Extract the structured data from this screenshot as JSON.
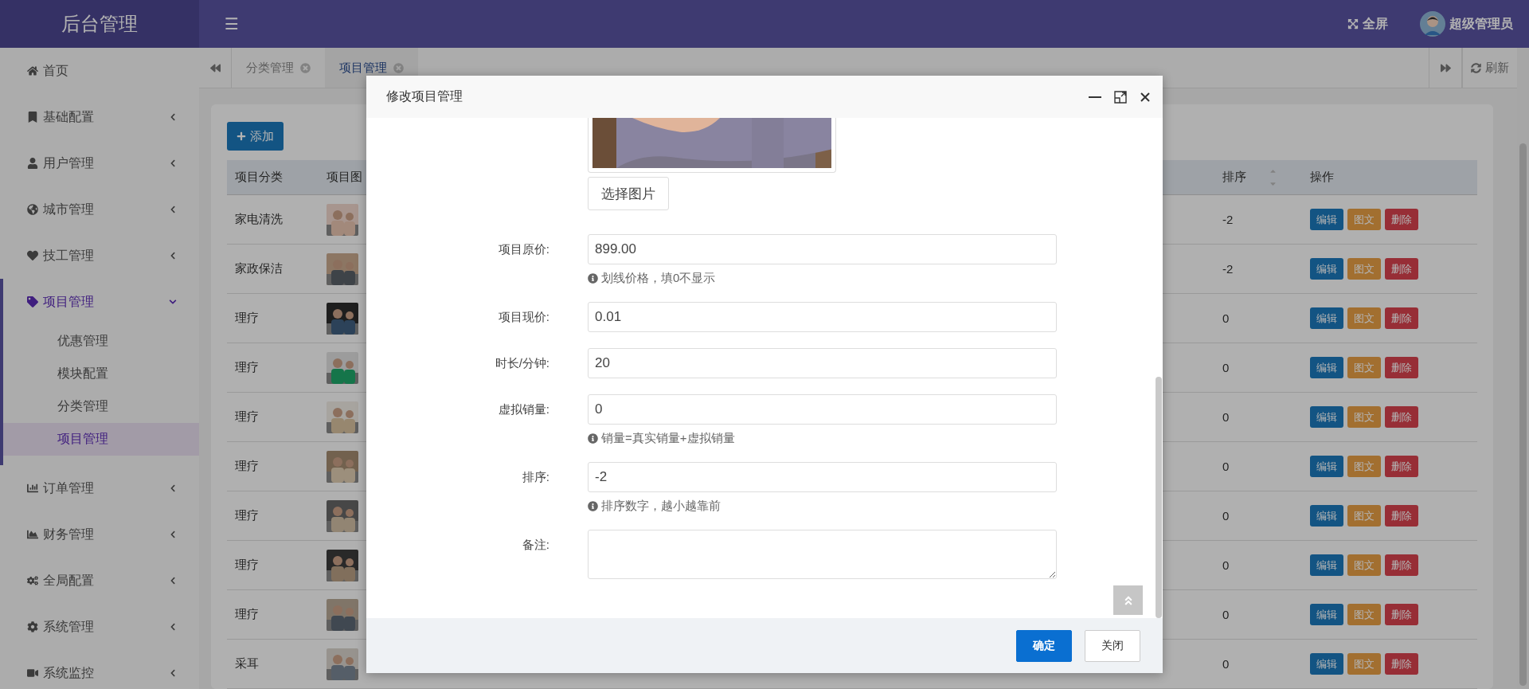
{
  "header": {
    "logo": "后台管理",
    "menu_icon": "☰",
    "fullscreen": "全屏",
    "user": "超级管理员"
  },
  "sidebar": {
    "items": [
      {
        "label": "首页",
        "has_children": false,
        "expanded": false
      },
      {
        "label": "基础配置",
        "has_children": true,
        "expanded": false
      },
      {
        "label": "用户管理",
        "has_children": true,
        "expanded": false
      },
      {
        "label": "城市管理",
        "has_children": true,
        "expanded": false
      },
      {
        "label": "技工管理",
        "has_children": true,
        "expanded": false
      },
      {
        "label": "项目管理",
        "has_children": true,
        "expanded": true,
        "children": [
          {
            "label": "优惠管理",
            "selected": false
          },
          {
            "label": "模块配置",
            "selected": false
          },
          {
            "label": "分类管理",
            "selected": false
          },
          {
            "label": "项目管理",
            "selected": true
          }
        ]
      },
      {
        "label": "订单管理",
        "has_children": true,
        "expanded": false
      },
      {
        "label": "财务管理",
        "has_children": true,
        "expanded": false
      },
      {
        "label": "全局配置",
        "has_children": true,
        "expanded": false
      },
      {
        "label": "系统管理",
        "has_children": true,
        "expanded": false
      },
      {
        "label": "系统监控",
        "has_children": true,
        "expanded": false
      }
    ]
  },
  "tabs": [
    {
      "label": "分类管理",
      "selected": false
    },
    {
      "label": "项目管理",
      "selected": true
    }
  ],
  "refresh": "刷新",
  "add_button": "添加",
  "table": {
    "columns": [
      "项目分类",
      "项目图"
    ],
    "sort_column": "排序",
    "action_column": "操作",
    "rows": [
      {
        "category": "家电清洗",
        "sort": "-2",
        "actions": [
          "编辑",
          "图文",
          "删除"
        ]
      },
      {
        "category": "家政保洁",
        "sort": "-2",
        "actions": [
          "编辑",
          "图文",
          "删除"
        ]
      },
      {
        "category": "理疗",
        "sort": "0",
        "actions": [
          "编辑",
          "图文",
          "删除"
        ]
      },
      {
        "category": "理疗",
        "sort": "0",
        "actions": [
          "编辑",
          "图文",
          "删除"
        ]
      },
      {
        "category": "理疗",
        "sort": "0",
        "actions": [
          "编辑",
          "图文",
          "删除"
        ]
      },
      {
        "category": "理疗",
        "sort": "0",
        "actions": [
          "编辑",
          "图文",
          "删除"
        ]
      },
      {
        "category": "理疗",
        "sort": "0",
        "actions": [
          "编辑",
          "图文",
          "删除"
        ]
      },
      {
        "category": "理疗",
        "sort": "0",
        "actions": [
          "编辑",
          "图文",
          "删除"
        ]
      },
      {
        "category": "理疗",
        "sort": "0",
        "actions": [
          "编辑",
          "图文",
          "删除"
        ]
      },
      {
        "category": "采耳",
        "sort": "0",
        "actions": [
          "编辑",
          "图文",
          "删除"
        ]
      }
    ]
  },
  "modal": {
    "title": "修改项目管理",
    "choose_image": "选择图片",
    "fields": [
      {
        "label": "项目原价:",
        "value": "899.00",
        "hint": "划线价格，填0不显示",
        "kind": "input"
      },
      {
        "label": "项目现价:",
        "value": "0.01",
        "kind": "input"
      },
      {
        "label": "时长/分钟:",
        "value": "20",
        "kind": "input"
      },
      {
        "label": "虚拟销量:",
        "value": "0",
        "hint": "销量=真实销量+虚拟销量",
        "kind": "input"
      },
      {
        "label": "排序:",
        "value": "-2",
        "hint": "排序数字，越小越靠前",
        "kind": "input"
      },
      {
        "label": "备注:",
        "kind": "textarea"
      }
    ],
    "buttons": [
      {
        "label": "确定",
        "primary": true
      },
      {
        "label": "关闭",
        "primary": false
      }
    ]
  }
}
